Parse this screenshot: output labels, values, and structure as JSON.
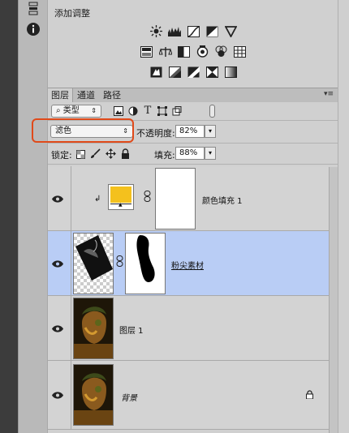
{
  "adjustments": {
    "title": "添加调整",
    "rows": [
      [
        "brightness-icon",
        "levels-icon",
        "curves-icon",
        "exposure-icon",
        "vibrance-icon"
      ],
      [
        "hue-saturation-icon",
        "color-balance-icon",
        "black-white-icon",
        "photo-filter-icon",
        "channel-mixer-icon",
        "color-lookup-icon"
      ],
      [
        "invert-icon",
        "posterize-icon",
        "threshold-icon",
        "selective-color-icon",
        "gradient-map-icon"
      ]
    ]
  },
  "layers_panel": {
    "tabs": [
      "图层",
      "通道",
      "路径"
    ],
    "active_tab": "图层",
    "filter": {
      "label": "类型",
      "icon": "search-icon"
    },
    "blend_mode": "滤色",
    "opacity_label": "不透明度:",
    "opacity_value": "82%",
    "lock_label": "锁定:",
    "fill_label": "填充:",
    "fill_value": "88%"
  },
  "layers": [
    {
      "name": "颜色填充 1",
      "type": "fill",
      "swatch_color": "#f4c11d",
      "selected": false,
      "locked": false
    },
    {
      "name": "粉尖素材",
      "type": "masked-image",
      "selected": true,
      "locked": false
    },
    {
      "name": "图层 1",
      "type": "image",
      "selected": false,
      "locked": false
    },
    {
      "name": "背景",
      "type": "image",
      "selected": false,
      "locked": true
    }
  ],
  "colors": {
    "selection": "#b9cdf5",
    "highlight_box": "#e04a1a"
  }
}
